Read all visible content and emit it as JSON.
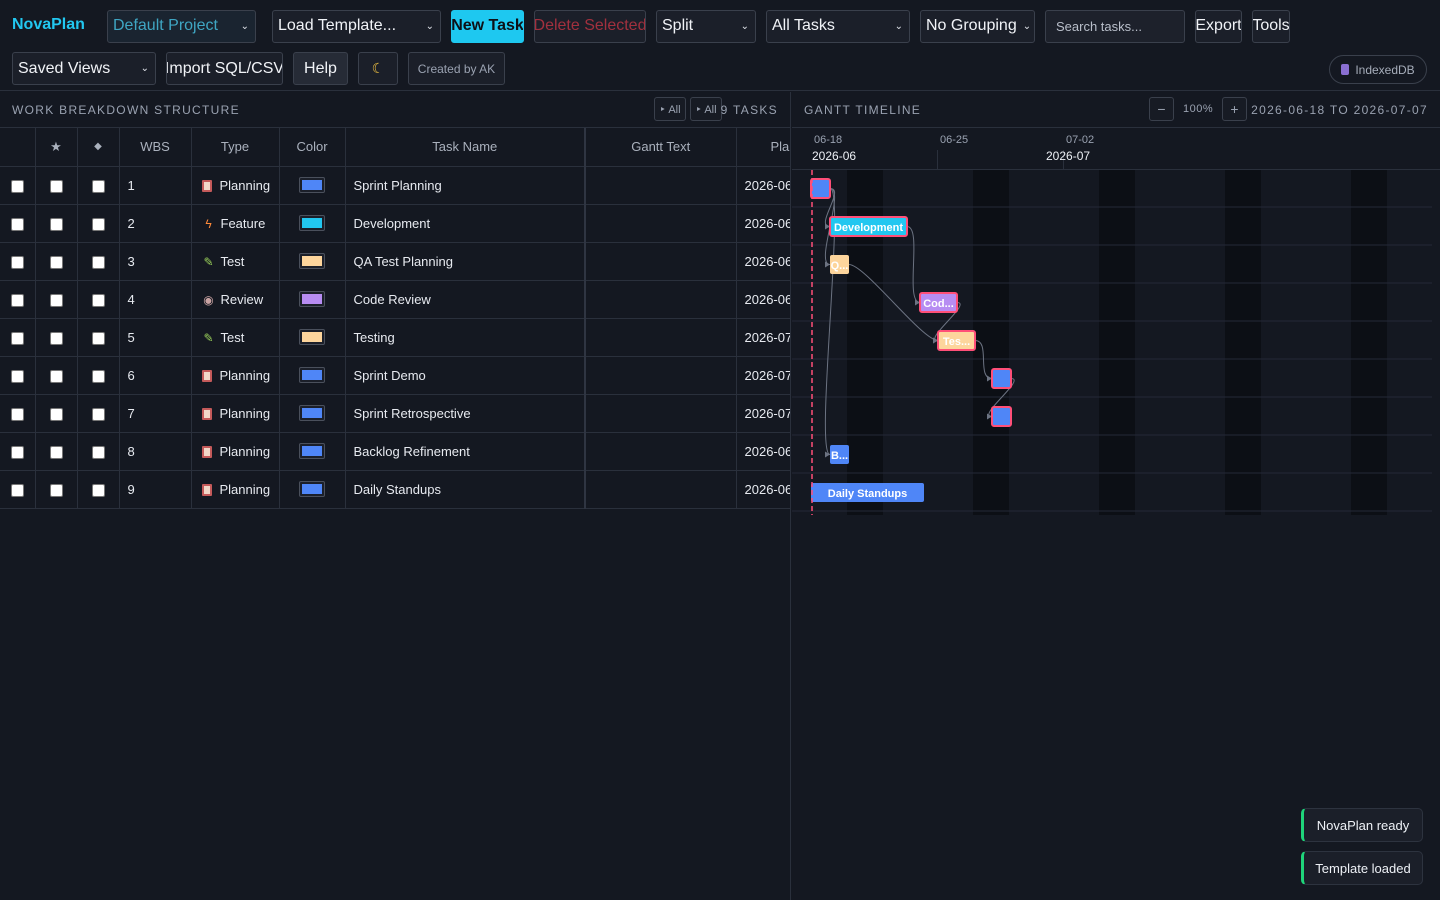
{
  "app": {
    "brand": "NovaPlan"
  },
  "toolbar": {
    "project_select": "Default Project",
    "template_select": "Load Template...",
    "new_task": "New Task",
    "delete_selected": "Delete Selected",
    "view_mode": "Split",
    "filter": "All Tasks",
    "grouping": "No Grouping",
    "search_placeholder": "Search tasks...",
    "export": "Export",
    "tools": "Tools",
    "saved_views": "Saved Views",
    "import": "Import SQL/CSV",
    "help": "Help",
    "theme_icon": "moon-icon",
    "credit": "Created by AK",
    "storage": "IndexedDB"
  },
  "wbs_panel": {
    "title": "Work Breakdown Structure",
    "expand_all": "‣ All",
    "collapse_all": "‣ All",
    "count": "9 TASKS",
    "columns": {
      "star": "★",
      "diamond": "◆",
      "wbs": "WBS",
      "type": "Type",
      "color": "Color",
      "name": "Task Name",
      "gantt_text": "Gantt Text",
      "plan": "Plan"
    }
  },
  "tasks": [
    {
      "wbs": "1",
      "type": "Planning",
      "icon": "clipboard-icon",
      "color": "#4f86f7",
      "name": "Sprint Planning",
      "gantt_text": "",
      "plan": "2026-06"
    },
    {
      "wbs": "2",
      "type": "Feature",
      "icon": "bolt-icon",
      "color": "#22c7f0",
      "name": "Development",
      "gantt_text": "",
      "plan": "2026-06"
    },
    {
      "wbs": "3",
      "type": "Test",
      "icon": "pencil-icon",
      "color": "#fdd59c",
      "name": "QA Test Planning",
      "gantt_text": "",
      "plan": "2026-06"
    },
    {
      "wbs": "4",
      "type": "Review",
      "icon": "eye-icon",
      "color": "#b78cf2",
      "name": "Code Review",
      "gantt_text": "",
      "plan": "2026-06"
    },
    {
      "wbs": "5",
      "type": "Test",
      "icon": "pencil-icon",
      "color": "#fdd59c",
      "name": "Testing",
      "gantt_text": "",
      "plan": "2026-07"
    },
    {
      "wbs": "6",
      "type": "Planning",
      "icon": "clipboard-icon",
      "color": "#4f86f7",
      "name": "Sprint Demo",
      "gantt_text": "",
      "plan": "2026-07"
    },
    {
      "wbs": "7",
      "type": "Planning",
      "icon": "clipboard-icon",
      "color": "#4f86f7",
      "name": "Sprint Retrospective",
      "gantt_text": "",
      "plan": "2026-07"
    },
    {
      "wbs": "8",
      "type": "Planning",
      "icon": "clipboard-icon",
      "color": "#4f86f7",
      "name": "Backlog Refinement",
      "gantt_text": "",
      "plan": "2026-06"
    },
    {
      "wbs": "9",
      "type": "Planning",
      "icon": "clipboard-icon",
      "color": "#4f86f7",
      "name": "Daily Standups",
      "gantt_text": "",
      "plan": "2026-06"
    }
  ],
  "gantt_panel": {
    "title": "Gantt Timeline",
    "zoom_out": "−",
    "zoom": "100%",
    "zoom_in": "+",
    "range": "2026-06-18 TO 2026-07-07",
    "week_ticks": [
      "06-18",
      "06-25",
      "07-02"
    ],
    "months": [
      "2026-06",
      "2026-07"
    ],
    "range_start": "2026-06-18",
    "today_marker": "2026-06-18"
  },
  "gantt_bars": [
    {
      "row": 0,
      "start": "2026-06-18",
      "end": "2026-06-18",
      "label": "",
      "color": "#4f86f7",
      "highlight": true
    },
    {
      "row": 1,
      "start": "2026-06-19",
      "end": "2026-06-22",
      "label": "Development",
      "color": "#22c7f0",
      "highlight": true
    },
    {
      "row": 2,
      "start": "2026-06-19",
      "end": "2026-06-19",
      "label": "Q...",
      "color": "#fdd59c",
      "highlight": false
    },
    {
      "row": 3,
      "start": "2026-06-24",
      "end": "2026-06-25",
      "label": "Cod...",
      "color": "#b78cf2",
      "highlight": true
    },
    {
      "row": 4,
      "start": "2026-06-25",
      "end": "2026-06-26",
      "label": "Tes...",
      "color": "#fdd59c",
      "highlight": true
    },
    {
      "row": 5,
      "start": "2026-06-28",
      "end": "2026-06-28",
      "label": "",
      "color": "#4f86f7",
      "highlight": true
    },
    {
      "row": 6,
      "start": "2026-06-28",
      "end": "2026-06-28",
      "label": "",
      "color": "#4f86f7",
      "highlight": true
    },
    {
      "row": 7,
      "start": "2026-06-19",
      "end": "2026-06-19",
      "label": "B...",
      "color": "#4f86f7",
      "highlight": false
    },
    {
      "row": 8,
      "start": "2026-06-18",
      "end": "2026-06-23",
      "label": "Daily Standups",
      "color": "#4f86f7",
      "highlight": false
    }
  ],
  "dependencies": [
    [
      0,
      1
    ],
    [
      0,
      2
    ],
    [
      0,
      7
    ],
    [
      1,
      3
    ],
    [
      2,
      4
    ],
    [
      3,
      4
    ],
    [
      4,
      5
    ],
    [
      5,
      6
    ]
  ],
  "toasts": [
    "NovaPlan ready",
    "Template loaded"
  ]
}
